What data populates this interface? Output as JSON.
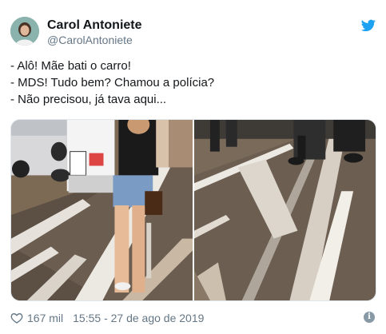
{
  "user": {
    "name": "Carol Antoniete",
    "handle": "@CarolAntoniete"
  },
  "tweet": {
    "lines": [
      "- Alô! Mãe bati o carro!",
      "- MDS! Tudo bem? Chamou a polícia?",
      "- Não precisou, já tava aqui..."
    ]
  },
  "footer": {
    "likes": "167 mil",
    "timestamp": "15:55 - 27 de ago de 2019",
    "info_glyph": "i"
  },
  "icons": {
    "twitter": "twitter-bird-icon",
    "like": "heart-icon",
    "info": "info-icon"
  },
  "colors": {
    "brand": "#1da1f2",
    "name": "#14171a",
    "muted": "#657786"
  }
}
